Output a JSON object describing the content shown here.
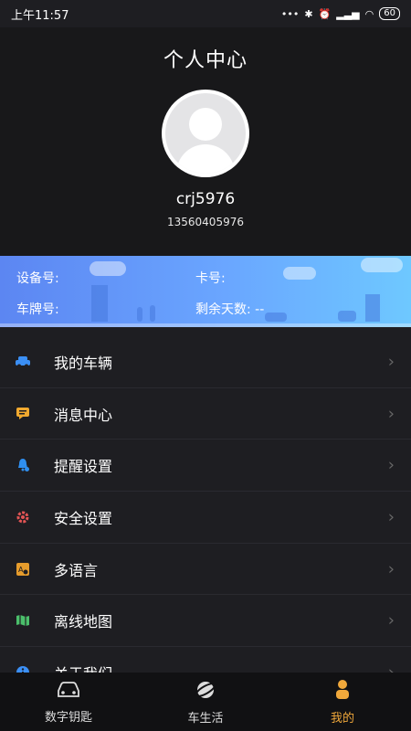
{
  "status": {
    "time": "上午11:57",
    "battery": "60"
  },
  "header": {
    "title": "个人中心",
    "username": "crj5976",
    "phone": "13560405976"
  },
  "info": {
    "device_label": "设备号:",
    "card_label": "卡号:",
    "plate_label": "车牌号:",
    "days_label": "剩余天数: --"
  },
  "menu": [
    {
      "label": "我的车辆",
      "icon": "car-icon",
      "color": "#3b8ff5"
    },
    {
      "label": "消息中心",
      "icon": "message-icon",
      "color": "#f1a92f"
    },
    {
      "label": "提醒设置",
      "icon": "bell-icon",
      "color": "#2f8ff0"
    },
    {
      "label": "安全设置",
      "icon": "gear-icon",
      "color": "#e45555"
    },
    {
      "label": "多语言",
      "icon": "language-icon",
      "color": "#e69c2c"
    },
    {
      "label": "离线地图",
      "icon": "map-icon",
      "color": "#4bbf6b"
    },
    {
      "label": "关于我们",
      "icon": "info-icon",
      "color": "#3b8ff5"
    }
  ],
  "tabs": [
    {
      "label": "数字钥匙",
      "icon": "car-key-icon"
    },
    {
      "label": "车生活",
      "icon": "planet-icon"
    },
    {
      "label": "我的",
      "icon": "profile-icon"
    }
  ],
  "colors": {
    "accent": "#f0a83b",
    "banner_start": "#5c86f2",
    "banner_end": "#6ec8ff"
  }
}
